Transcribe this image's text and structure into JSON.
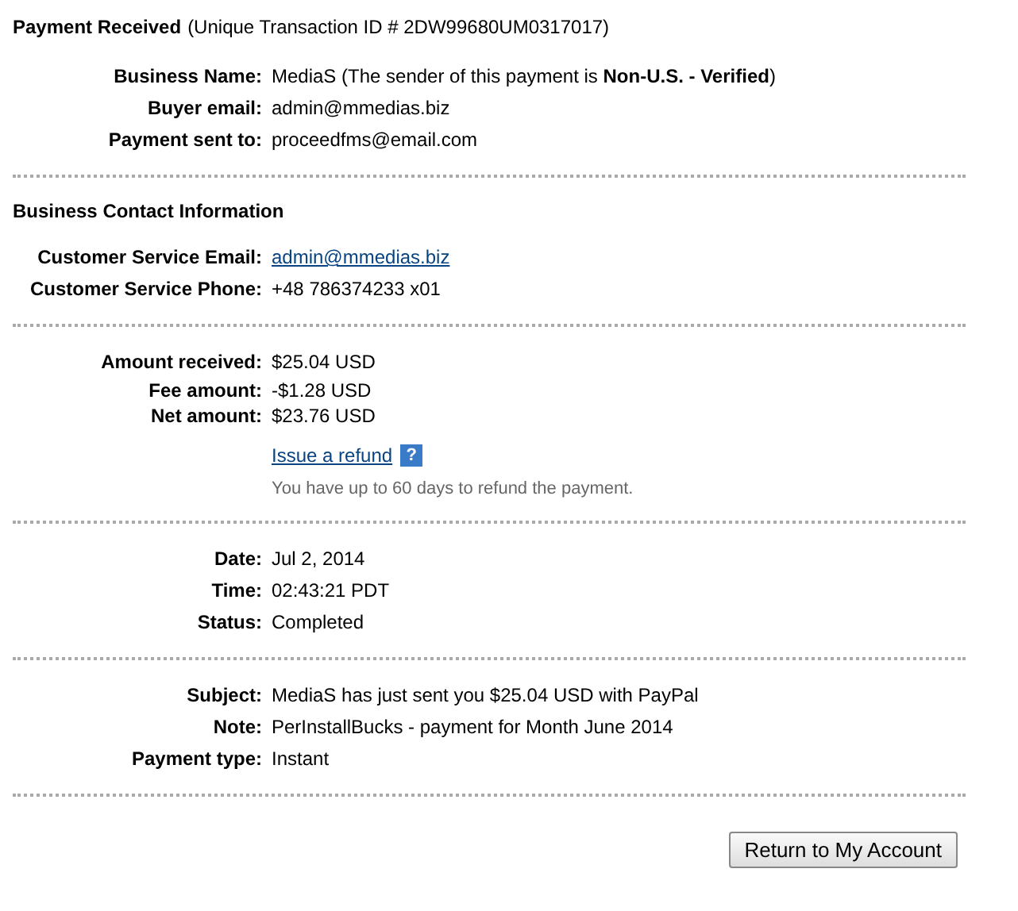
{
  "title": {
    "heading": "Payment Received",
    "detail": "(Unique Transaction ID # 2DW99680UM0317017)"
  },
  "sections": [
    {
      "rows": [
        {
          "label": "Business Name:",
          "value": "MediaS (The sender of this payment is **Non-U.S. - Verified**)",
          "kind": "text"
        },
        {
          "label": "Buyer email:",
          "value": "admin@mmedias.biz",
          "kind": "text"
        },
        {
          "label": "Payment sent to:",
          "value": "proceedfms@email.com",
          "kind": "text"
        }
      ]
    },
    {
      "heading": "Business Contact Information",
      "rows": [
        {
          "label": "Customer Service Email:",
          "value": "admin@mmedias.biz",
          "kind": "link"
        },
        {
          "label": "Customer Service Phone:",
          "value": "+48 786374233 x01",
          "kind": "text"
        }
      ]
    },
    {
      "rows": [
        {
          "label": "Amount received:",
          "value": "$25.04 USD",
          "kind": "text"
        },
        {
          "label": "Fee amount:",
          "value": "-$1.28 USD",
          "kind": "tight"
        },
        {
          "label": "Net amount:",
          "value": "$23.76 USD",
          "kind": "tight"
        }
      ],
      "refund": {
        "link": "Issue a refund",
        "help": "?",
        "note": "You have up to 60 days to refund the payment."
      }
    },
    {
      "rows": [
        {
          "label": "Date:",
          "value": "Jul 2, 2014",
          "kind": "text"
        },
        {
          "label": "Time:",
          "value": "02:43:21 PDT",
          "kind": "text"
        },
        {
          "label": "Status:",
          "value": "Completed",
          "kind": "text"
        }
      ]
    },
    {
      "rows": [
        {
          "label": "Subject:",
          "value": "MediaS has just sent you $25.04 USD with PayPal",
          "kind": "text"
        },
        {
          "label": "Note:",
          "value": "PerInstallBucks - payment for Month June 2014",
          "kind": "text"
        },
        {
          "label": "Payment type:",
          "value": "Instant",
          "kind": "text"
        }
      ]
    }
  ],
  "button": "Return to My Account"
}
